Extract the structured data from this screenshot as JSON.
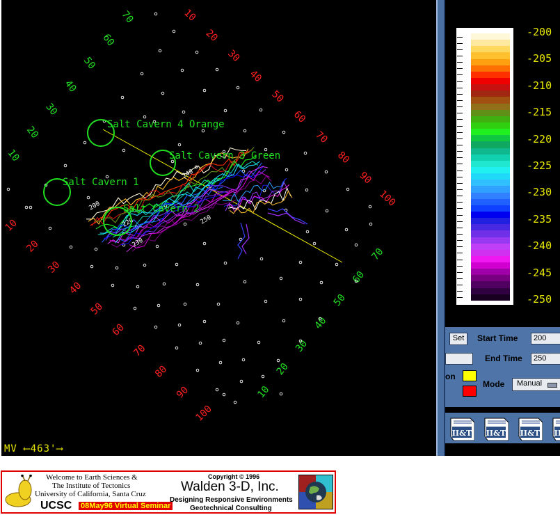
{
  "viewport": {
    "background_color": "#000000",
    "grid_colors": {
      "red": "#ff2020",
      "green": "#20e020",
      "points": "#ffffff"
    },
    "grid_labels_red_top": [
      "10",
      "20",
      "30",
      "40",
      "50",
      "60",
      "70",
      "80",
      "90",
      "100"
    ],
    "grid_labels_green_left": [
      "70",
      "60",
      "50",
      "40",
      "30",
      "20",
      "10"
    ],
    "grid_labels_red_left": [
      "10",
      "20",
      "30",
      "40",
      "50",
      "60",
      "70",
      "80",
      "90",
      "100"
    ],
    "grid_labels_green_right": [
      "70",
      "60",
      "50",
      "40",
      "30",
      "20",
      "10"
    ],
    "caverns": [
      {
        "label": "Salt Cavern 4 Orange"
      },
      {
        "label": "Salt Cavern 3 Green"
      },
      {
        "label": "Salt Cavern 1"
      },
      {
        "label": "Salt Cavern 2"
      }
    ],
    "contour_labels": [
      "200",
      "220",
      "230",
      "240",
      "250"
    ],
    "scale_bar": "MV ⟵463'⟶"
  },
  "colorbar": {
    "colors": [
      "#fff8d8",
      "#ffe9a0",
      "#ffd860",
      "#ffc030",
      "#ffa010",
      "#ff7000",
      "#ff3000",
      "#f00000",
      "#c81010",
      "#a02810",
      "#a05010",
      "#907018",
      "#609018",
      "#40b010",
      "#30d010",
      "#20f020",
      "#10c840",
      "#10a860",
      "#10b890",
      "#10d0b0",
      "#20e8d0",
      "#20f0f0",
      "#20d8f8",
      "#30c0ff",
      "#30a0ff",
      "#3080ff",
      "#2060ff",
      "#1040ff",
      "#0000f0",
      "#2020e0",
      "#4828e0",
      "#7030e8",
      "#9838f0",
      "#c040f8",
      "#d030f0",
      "#f018f0",
      "#d000d0",
      "#a000a8",
      "#780080",
      "#500060",
      "#300040",
      "#180020"
    ],
    "labels": [
      "-200",
      "-205",
      "-210",
      "-215",
      "-220",
      "-225",
      "-230",
      "-235",
      "-240",
      "-245",
      "-250"
    ]
  },
  "controls": {
    "set_button": "Set",
    "start_time_label": "Start Time",
    "start_time_value": "200",
    "end_time_label": "End Time",
    "end_time_value": "250",
    "partial_label": "on",
    "mode_label": "Mode",
    "mode_value": "Manual",
    "swatch_colors": [
      "#ffff00",
      "#ff0000"
    ]
  },
  "icons": [
    {
      "name": "iit-logo-icon",
      "text": "II&T"
    },
    {
      "name": "iit-logo-icon",
      "text": "II&T"
    },
    {
      "name": "iit-logo-icon",
      "text": "II&T"
    },
    {
      "name": "iit-logo-icon",
      "text": "II&T"
    }
  ],
  "banner": {
    "welcome_line1": "Welcome to Earth Sciences &",
    "welcome_line2": "The Institute of Tectonics",
    "welcome_line3": "University of California, Santa Cruz",
    "ucsc": "UCSC",
    "seminar": "08May96 Virtual Seminar",
    "copyright": "Copyright © 1996",
    "company": "Walden 3-D, Inc.",
    "tagline1": "Designing Responsive Environments",
    "tagline2": "Geotechnical Consulting"
  }
}
